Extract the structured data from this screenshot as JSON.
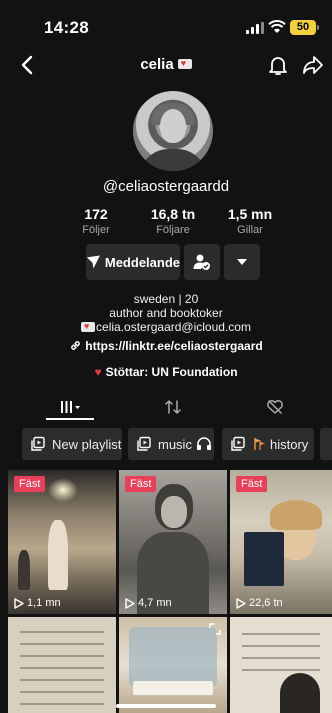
{
  "status_bar": {
    "time": "14:28",
    "battery": "50"
  },
  "nav": {
    "title": "celia"
  },
  "profile": {
    "handle": "@celiaostergaardd",
    "stats": [
      {
        "value": "172",
        "label": "Följer"
      },
      {
        "value": "16,8 tn",
        "label": "Följare"
      },
      {
        "value": "1,5 mn",
        "label": "Gillar"
      }
    ],
    "message_button": "Meddelande",
    "bio_line1": "sweden | 20",
    "bio_line2": "author and booktoker",
    "bio_email": "celia.ostergaard@icloud.com",
    "link": "https://linktr.ee/celiaostergaard",
    "support": "Stöttar: UN Foundation"
  },
  "playlists": [
    {
      "label": "New playlist",
      "icon": "playlist-icon"
    },
    {
      "label": "music",
      "icon": "headphones-icon"
    },
    {
      "label": "history",
      "icon": "playlist-icon"
    }
  ],
  "videos": [
    {
      "pinned": "Fäst",
      "views": "1,1 mn"
    },
    {
      "pinned": "Fäst",
      "views": "4,7 mn"
    },
    {
      "pinned": "Fäst",
      "views": "22,6 tn"
    },
    {
      "pinned": "",
      "views": ""
    },
    {
      "pinned": "",
      "views": ""
    },
    {
      "pinned": "",
      "views": ""
    }
  ],
  "colors": {
    "background": "#121212",
    "pin_badge": "#e9405a",
    "button_bg": "#2b2b2b"
  }
}
